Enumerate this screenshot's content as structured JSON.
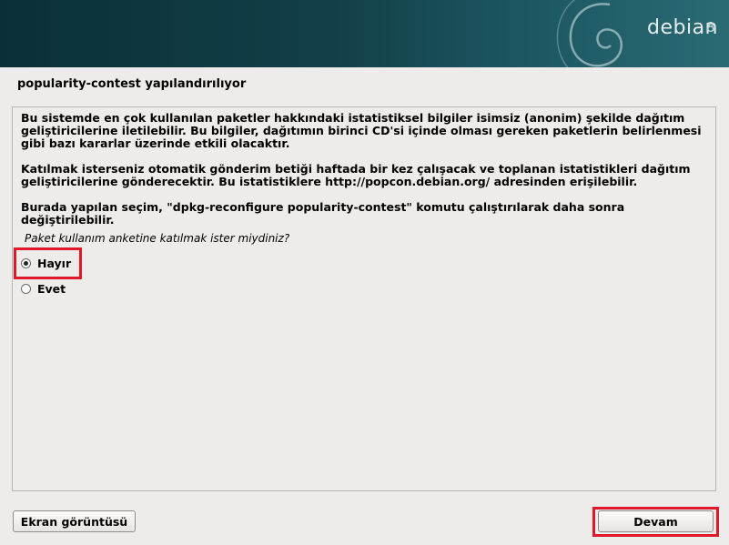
{
  "banner": {
    "logo_text": "debian",
    "logo_version": "8"
  },
  "page": {
    "title": "popularity-contest yapılandırılıyor"
  },
  "content": {
    "paragraphs": [
      "Bu sistemde en çok kullanılan paketler hakkındaki istatistiksel bilgiler isimsiz (anonim) şekilde dağıtım\ngeliştiricilerine iletilebilir. Bu bilgiler, dağıtımın birinci CD'si içinde olması gereken paketlerin belirlenmesi\ngibi bazı kararlar üzerinde etkili olacaktır.",
      "Katılmak isterseniz otomatik gönderim betiği haftada bir kez çalışacak ve toplanan istatistikleri dağıtım\ngeliştiricilerine gönderecektir. Bu istatistiklere http://popcon.debian.org/ adresinden erişilebilir.",
      "Burada yapılan seçim, \"dpkg-reconfigure popularity-contest\" komutu çalıştırılarak daha sonra\ndeğiştirilebilir."
    ],
    "question": "Paket kullanım anketine katılmak ister miydiniz?",
    "options": [
      {
        "label": "Hayır",
        "selected": true
      },
      {
        "label": "Evet",
        "selected": false
      }
    ]
  },
  "buttons": {
    "screenshot": "Ekran görüntüsü",
    "continue": "Devam"
  },
  "colors": {
    "highlight": "#e0182a",
    "banner": "#0b2f38"
  }
}
